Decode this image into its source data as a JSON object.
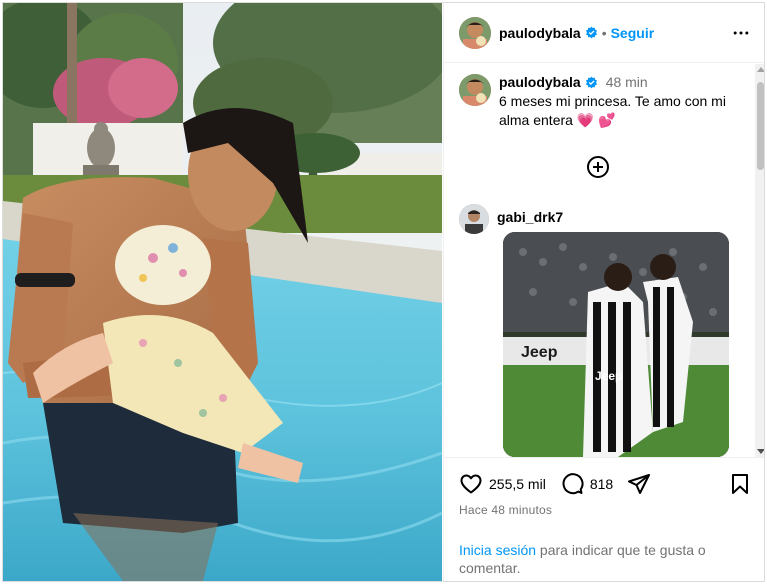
{
  "post": {
    "author": "paulodybala",
    "verified": true,
    "follow_label": "Seguir",
    "more_icon": "more-horizontal-icon",
    "caption_time": "48 min",
    "caption_text": "6 meses mi princesa. Te amo con mi alma entera 💗 💕",
    "photo_alt": "",
    "add_icon": "plus-circle-icon"
  },
  "comments": [
    {
      "username": "gabi_drk7",
      "attachment": "gif"
    }
  ],
  "gif_text": {
    "board": "Jeep",
    "shirt": "Jeep"
  },
  "actions": {
    "likes": "255,5 mil",
    "comments": "818",
    "like_icon": "heart-icon",
    "comment_icon": "comment-icon",
    "share_icon": "share-icon",
    "save_icon": "bookmark-icon"
  },
  "timestamp": "Hace 48 minutos",
  "login_prompt": {
    "link": "Inicia sesión",
    "text": " para indicar que te gusta o comentar."
  },
  "colors": {
    "accent": "#0095f6",
    "muted": "#737373",
    "verified": "#0095f6",
    "pool": "#6cc5d9"
  }
}
